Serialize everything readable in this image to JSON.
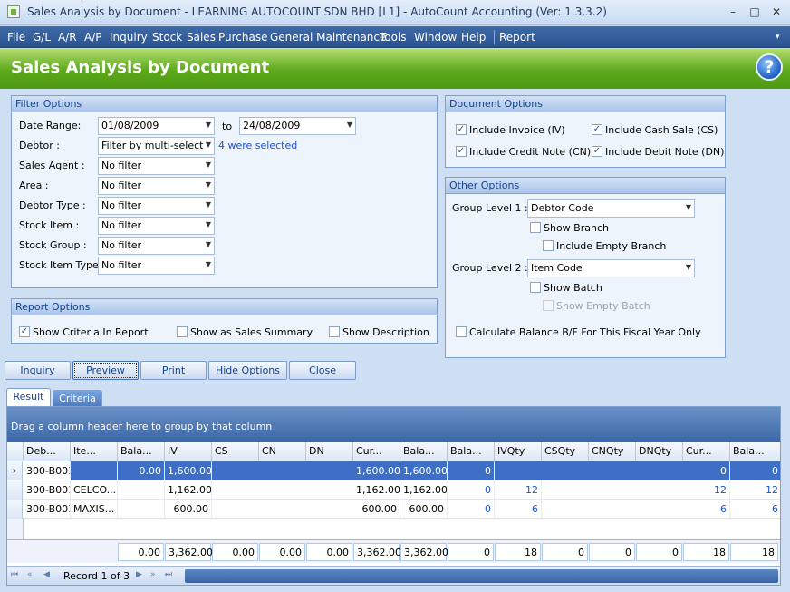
{
  "window": {
    "title": "Sales Analysis by Document - LEARNING AUTOCOUNT SDN BHD [L1] - AutoCount Accounting (Ver: 1.3.3.2)",
    "min": "–",
    "max": "□",
    "close": "✕"
  },
  "menu": [
    "File",
    "G/L",
    "A/R",
    "A/P",
    "Inquiry",
    "Stock",
    "Sales",
    "Purchase",
    "General Maintenance",
    "Tools",
    "Window",
    "Help",
    "Report"
  ],
  "menu_more": "▾",
  "banner": {
    "title": "Sales Analysis by Document",
    "help": "?"
  },
  "filter": {
    "title": "Filter Options",
    "date_label": "Date Range:",
    "date_from": "01/08/2009",
    "to_label": "to",
    "date_to": "24/08/2009",
    "debtor_label": "Debtor :",
    "debtor_value": "Filter by multi-select",
    "debtor_link": "4 were selected",
    "agent_label": "Sales Agent :",
    "agent_value": "No filter",
    "area_label": "Area :",
    "area_value": "No filter",
    "dtype_label": "Debtor Type :",
    "dtype_value": "No filter",
    "sitem_label": "Stock Item :",
    "sitem_value": "No filter",
    "sgroup_label": "Stock Group :",
    "sgroup_value": "No filter",
    "sitype_label": "Stock Item Type :",
    "sitype_value": "No filter"
  },
  "report_options": {
    "title": "Report Options",
    "show_criteria": "Show Criteria In Report",
    "show_summary": "Show as Sales Summary",
    "show_desc": "Show Description"
  },
  "doc_options": {
    "title": "Document Options",
    "inv": "Include Invoice (IV)",
    "cs": "Include Cash Sale (CS)",
    "cn": "Include Credit Note (CN)",
    "dn": "Include Debit Note (DN)"
  },
  "other_options": {
    "title": "Other Options",
    "gl1_label": "Group Level 1 :",
    "gl1_value": "Debtor Code",
    "show_branch": "Show Branch",
    "empty_branch": "Include Empty Branch",
    "gl2_label": "Group Level 2 :",
    "gl2_value": "Item Code",
    "show_batch": "Show Batch",
    "empty_batch": "Show Empty Batch",
    "calc_bf": "Calculate Balance B/F For This Fiscal Year Only"
  },
  "buttons": {
    "inquiry": "Inquiry",
    "preview": "Preview",
    "print": "Print",
    "hide": "Hide Options",
    "close": "Close"
  },
  "tabs": {
    "result": "Result",
    "criteria": "Criteria"
  },
  "grid": {
    "group_hint": "Drag a column header here to group by that column",
    "headers": [
      "Deb...",
      "Ite...",
      "Bala...",
      "IV",
      "CS",
      "CN",
      "DN",
      "Cur...",
      "Bala...",
      "Bala...",
      "IVQty",
      "CSQty",
      "CNQty",
      "DNQty",
      "Cur...",
      "Bala..."
    ],
    "rows": [
      [
        "300-B001",
        "",
        "0.00",
        "1,600.00",
        "",
        "",
        "",
        "1,600.00",
        "1,600.00",
        "0",
        "",
        "",
        "",
        "",
        "0",
        "0"
      ],
      [
        "300-B001",
        "CELCO...",
        "",
        "1,162.00",
        "",
        "",
        "",
        "1,162.00",
        "1,162.00",
        "0",
        "12",
        "",
        "",
        "",
        "12",
        "12"
      ],
      [
        "300-B001",
        "MAXIS...",
        "",
        "600.00",
        "",
        "",
        "",
        "600.00",
        "600.00",
        "0",
        "6",
        "",
        "",
        "",
        "6",
        "6"
      ]
    ],
    "totals": [
      "0.00",
      "3,362.00",
      "0.00",
      "0.00",
      "0.00",
      "3,362.00",
      "3,362.00",
      "0",
      "18",
      "0",
      "0",
      "0",
      "18",
      "18"
    ],
    "record": "Record 1 of 3",
    "current_marker": "›"
  },
  "icons": {
    "nav_first": "⏮",
    "nav_prev_page": "«",
    "nav_prev": "◀",
    "nav_next": "▶",
    "nav_next_page": "»",
    "nav_last": "⏭",
    "check": "✓",
    "dropdown": "▼"
  }
}
